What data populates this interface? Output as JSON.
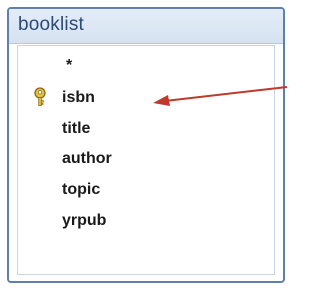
{
  "table": {
    "title": "booklist",
    "fields": [
      "*",
      "isbn",
      "title",
      "author",
      "topic",
      "yrpub"
    ]
  },
  "icons": {
    "primary_key": "key-icon",
    "pointer": "arrow-icon"
  },
  "colors": {
    "title_bar": "#d6e2f1",
    "border": "#5f7fae",
    "title_text": "#2b4a74",
    "key": "#c89a14",
    "arrow": "#c0392b"
  }
}
